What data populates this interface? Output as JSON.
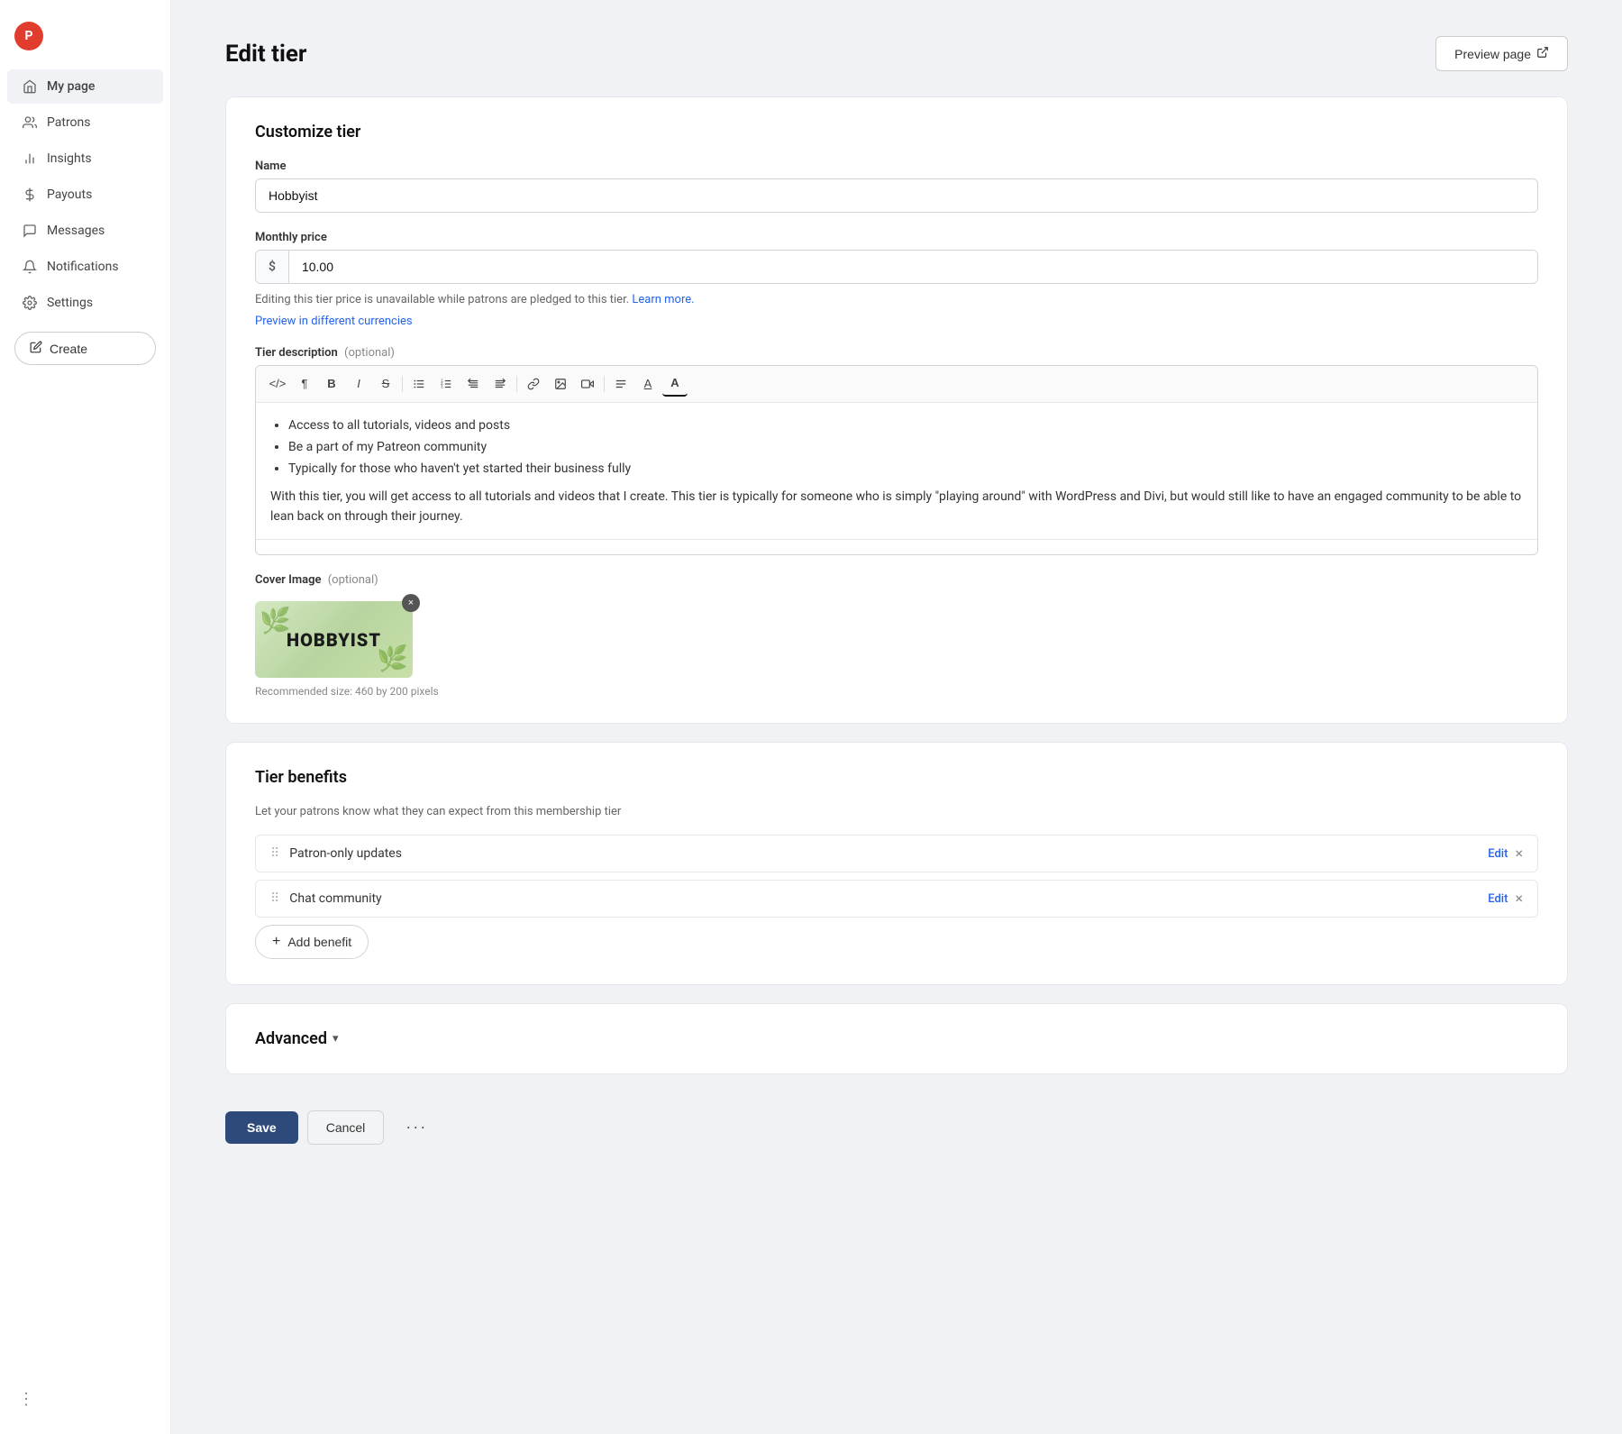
{
  "app": {
    "logo_text": "P"
  },
  "sidebar": {
    "items": [
      {
        "id": "my-page",
        "label": "My page",
        "icon": "home"
      },
      {
        "id": "patrons",
        "label": "Patrons",
        "icon": "users"
      },
      {
        "id": "insights",
        "label": "Insights",
        "icon": "bar-chart"
      },
      {
        "id": "payouts",
        "label": "Payouts",
        "icon": "dollar"
      },
      {
        "id": "messages",
        "label": "Messages",
        "icon": "message"
      },
      {
        "id": "notifications",
        "label": "Notifications",
        "icon": "bell"
      },
      {
        "id": "settings",
        "label": "Settings",
        "icon": "gear"
      }
    ],
    "active_item": "my-page",
    "create_label": "Create"
  },
  "header": {
    "title": "Edit tier",
    "preview_label": "Preview page"
  },
  "customize": {
    "section_title": "Customize tier",
    "name_label": "Name",
    "name_value": "Hobbyist",
    "price_label": "Monthly price",
    "price_symbol": "$",
    "price_value": "10.00",
    "price_note": "Editing this tier price is unavailable while patrons are pledged to this tier.",
    "learn_more_label": "Learn more.",
    "preview_currencies_label": "Preview in different currencies",
    "description_label": "Tier description",
    "description_optional": "(optional)",
    "description_bullets": [
      "Access to all tutorials, videos and posts",
      "Be a part of my Patreon community",
      "Typically for those who haven't yet started their business fully"
    ],
    "description_body": "With this tier, you will get access to all tutorials and videos that I create. This tier is typically for someone who is simply \"playing around\" with WordPress and Divi, but would still like to have an engaged community to be able to lean back on through their journey.",
    "cover_label": "Cover Image",
    "cover_optional": "(optional)",
    "cover_image_text": "HOBBYIST",
    "cover_hint": "Recommended size: 460 by 200 pixels"
  },
  "benefits": {
    "section_title": "Tier benefits",
    "section_subtitle": "Let your patrons know what they can expect from this membership tier",
    "items": [
      {
        "label": "Patron-only updates"
      },
      {
        "label": "Chat community"
      }
    ],
    "edit_label": "Edit",
    "add_label": "Add benefit"
  },
  "advanced": {
    "section_title": "Advanced"
  },
  "footer": {
    "save_label": "Save",
    "cancel_label": "Cancel",
    "more_label": "···"
  },
  "toolbar": {
    "buttons": [
      {
        "id": "code",
        "label": "</>"
      },
      {
        "id": "paragraph",
        "label": "¶"
      },
      {
        "id": "bold",
        "label": "B"
      },
      {
        "id": "italic",
        "label": "I"
      },
      {
        "id": "strikethrough",
        "label": "S"
      },
      {
        "id": "bullet-list",
        "label": "≡"
      },
      {
        "id": "ordered-list",
        "label": "⊟"
      },
      {
        "id": "outdent",
        "label": "⇤"
      },
      {
        "id": "indent",
        "label": "⇥"
      },
      {
        "id": "link",
        "label": "🔗"
      },
      {
        "id": "image",
        "label": "🖼"
      },
      {
        "id": "video",
        "label": "▶"
      },
      {
        "id": "align",
        "label": "≣"
      },
      {
        "id": "underline",
        "label": "U̲"
      },
      {
        "id": "text-color",
        "label": "A"
      }
    ]
  }
}
